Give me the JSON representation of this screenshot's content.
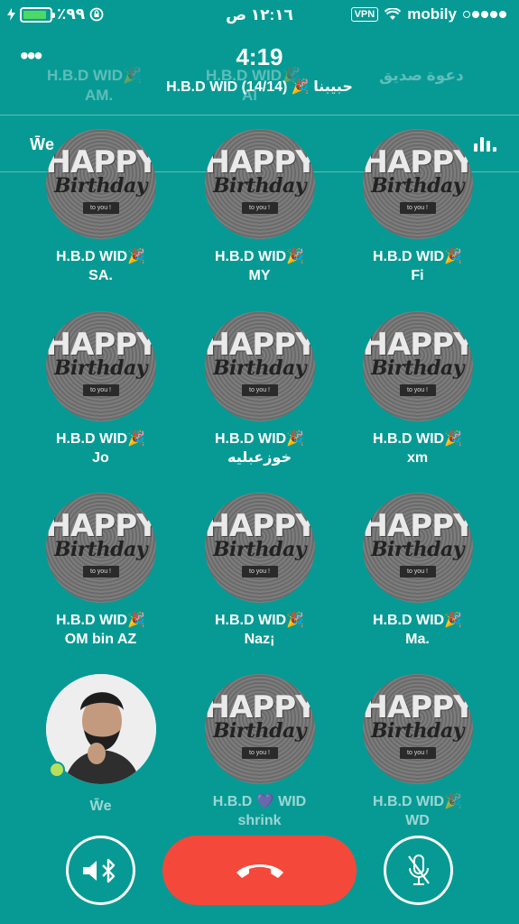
{
  "status_bar": {
    "battery_text": "٪٩٩",
    "time": "١٢:١٦ ص",
    "vpn": "VPN",
    "carrier": "mobily"
  },
  "header": {
    "timer": "4:19",
    "group_title": "H.B.D WID (14/14) 🎉 حبيبنا",
    "more_label": "•••",
    "ghost_labels": [
      "H.B.D WID🎉",
      "AM.",
      "H.B.D WID🎉",
      "Al",
      "دعوة صديق"
    ]
  },
  "speaker": {
    "name": "W̄e"
  },
  "participants": [
    {
      "line1": "H.B.D WID🎉",
      "line2": "SA.",
      "avatar": "happy-birthday"
    },
    {
      "line1": "H.B.D WID🎉",
      "line2": "MY",
      "avatar": "happy-birthday"
    },
    {
      "line1": "H.B.D WID🎉",
      "line2": "Fi",
      "avatar": "happy-birthday"
    },
    {
      "line1": "H.B.D WID🎉",
      "line2": "Jo",
      "avatar": "happy-birthday"
    },
    {
      "line1": "H.B.D WID🎉",
      "line2": "خوزعبليه",
      "avatar": "happy-birthday"
    },
    {
      "line1": "H.B.D WID🎉",
      "line2": "xm",
      "avatar": "happy-birthday"
    },
    {
      "line1": "H.B.D WID🎉",
      "line2": "OM bin AZ",
      "avatar": "happy-birthday"
    },
    {
      "line1": "H.B.D WID🎉",
      "line2": "Naz¡",
      "avatar": "happy-birthday"
    },
    {
      "line1": "H.B.D WID🎉",
      "line2": "Ma.",
      "avatar": "happy-birthday"
    },
    {
      "line1": "",
      "line2": "W̄e",
      "avatar": "photo",
      "online": true
    },
    {
      "line1": "H.B.D 💜 WID",
      "line2": "shrink",
      "avatar": "happy-birthday"
    },
    {
      "line1": "H.B.D WID🎉",
      "line2": "WD",
      "avatar": "happy-birthday"
    }
  ],
  "avatar_art": {
    "happy": "HAPPY",
    "birthday": "Birthday",
    "to_you": "to you !"
  },
  "controls": {
    "speaker_icon": "bluetooth-speaker-icon",
    "end_icon": "phone-hangup-icon",
    "mute_icon": "mic-off-icon"
  },
  "colors": {
    "background": "#079a94",
    "end_call": "#f4493a",
    "battery": "#4cd964",
    "online_dot": "#b7e05a"
  }
}
